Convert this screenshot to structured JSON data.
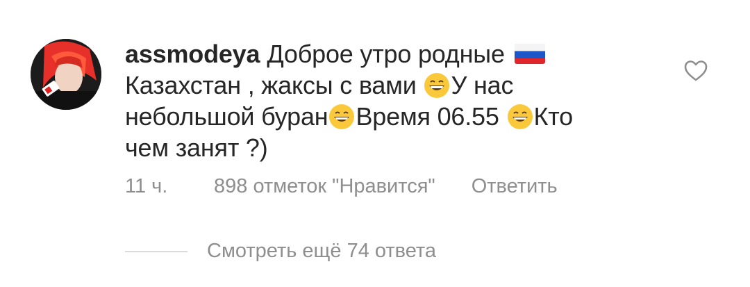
{
  "comment": {
    "username": "assmodeya",
    "text_line1": "Доброе утро родные",
    "text_line2a": "Казахстан , жаксы с вами",
    "text_line2b": "У нас",
    "text_line3a": "небольшой буран",
    "text_line3b": "Время 06.55",
    "text_line3c": "Кто",
    "text_line4": "чем занят ?)",
    "emojis": [
      "flag-russia-icon",
      "grinning-face-icon"
    ]
  },
  "meta": {
    "time": "11 ч.",
    "likes": "898 отметок \"Нравится\"",
    "reply_label": "Ответить"
  },
  "replies": {
    "view_more_label": "Смотреть ещё 74 ответа"
  },
  "colors": {
    "text": "#262626",
    "secondary": "#8e8e8e",
    "divider": "#dbdbdb"
  }
}
